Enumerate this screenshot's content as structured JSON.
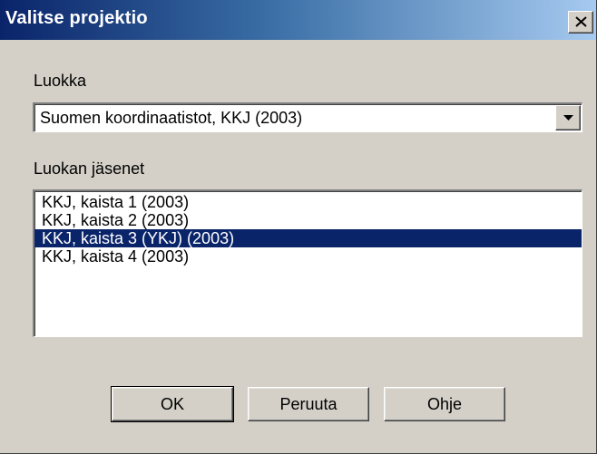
{
  "window": {
    "title": "Valitse projektio",
    "close_icon": "close-icon"
  },
  "category": {
    "label": "Luokka",
    "selected": "Suomen koordinaatistot, KKJ (2003)",
    "dropdown_icon": "chevron-down-icon"
  },
  "members": {
    "label": "Luokan jäsenet",
    "items": [
      "KKJ, kaista 1 (2003)",
      "KKJ, kaista 2 (2003)",
      "KKJ, kaista 3 (YKJ) (2003)",
      "KKJ, kaista 4 (2003)"
    ],
    "selected_index": 2
  },
  "buttons": {
    "ok": "OK",
    "cancel": "Peruuta",
    "help": "Ohje"
  },
  "colors": {
    "selection": "#0a246a",
    "dialog_bg": "#d4d0c8"
  }
}
